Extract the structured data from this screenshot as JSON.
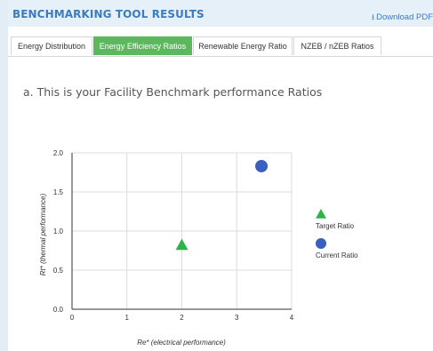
{
  "header": {
    "title": "BENCHMARKING TOOL RESULTS",
    "download_label": "Download PDF",
    "download_icon": "download-icon"
  },
  "tabs": [
    {
      "label": "Energy Distribution",
      "active": false
    },
    {
      "label": "Energy Efficiency Ratios",
      "active": true
    },
    {
      "label": "Renewable Energy Ratio",
      "active": false
    },
    {
      "label": "NZEB / nZEB Ratios",
      "active": false
    }
  ],
  "subtitle": "a. This is your Facility Benchmark performance Ratios",
  "colors": {
    "accent": "#3b7bbf",
    "active_tab": "#5cb85c",
    "target": "#2db34a",
    "current": "#3a5fbf"
  },
  "chart_data": {
    "type": "scatter",
    "xlabel": "Re* (electrical performance)",
    "ylabel": "Rt* (thermal performance)",
    "xlim": [
      0,
      4
    ],
    "ylim": [
      0,
      2
    ],
    "x_ticks": [
      "0",
      "1",
      "2",
      "3",
      "4"
    ],
    "y_ticks": [
      "0.0",
      "0.5",
      "1.0",
      "1.5",
      "2.0"
    ],
    "grid": true,
    "legend_position": "right",
    "series": [
      {
        "name": "Target Ratio",
        "marker": "triangle",
        "color": "#2db34a",
        "points": [
          {
            "x": 2.0,
            "y": 0.8
          }
        ]
      },
      {
        "name": "Current Ratio",
        "marker": "circle",
        "color": "#3a5fbf",
        "points": [
          {
            "x": 3.45,
            "y": 1.83
          }
        ]
      }
    ]
  }
}
